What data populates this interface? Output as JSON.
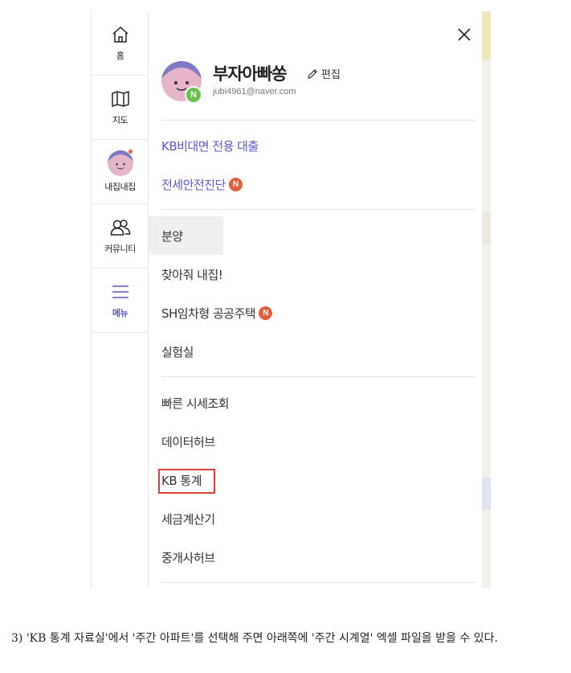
{
  "rail": {
    "items": [
      {
        "label": "홈",
        "icon": "home-icon"
      },
      {
        "label": "지도",
        "icon": "map-icon"
      },
      {
        "label": "내집내집",
        "icon": "avatar"
      },
      {
        "label": "커뮤니티",
        "icon": "community-icon"
      },
      {
        "label": "메뉴",
        "icon": "menu-icon"
      }
    ]
  },
  "profile": {
    "nickname": "부자아빠쏭",
    "edit_label": "편집",
    "email": "jubi4961@naver.com",
    "badge": "N"
  },
  "menu": {
    "group1": [
      "KB비대면 전용 대출",
      "전세안전진단"
    ],
    "group2": [
      "분양",
      "찾아줘 내집!",
      "SH임차형 공공주택",
      "실험실"
    ],
    "group3": [
      "빠른 시세조회",
      "데이터허브",
      "KB 통계",
      "세금계산기",
      "중개사허브"
    ],
    "new_badge": "N"
  },
  "colors": {
    "accent": "#5b57c8",
    "badge": "#e0603b",
    "naver": "#67c14d",
    "highlight_box": "#d9403a"
  },
  "caption": "3) 'KB 통계 자료실'에서 '주간 아파트'를 선택해 주면 아래쪽에 '주간 시계열' 엑셀 파일을 받을 수 있다."
}
